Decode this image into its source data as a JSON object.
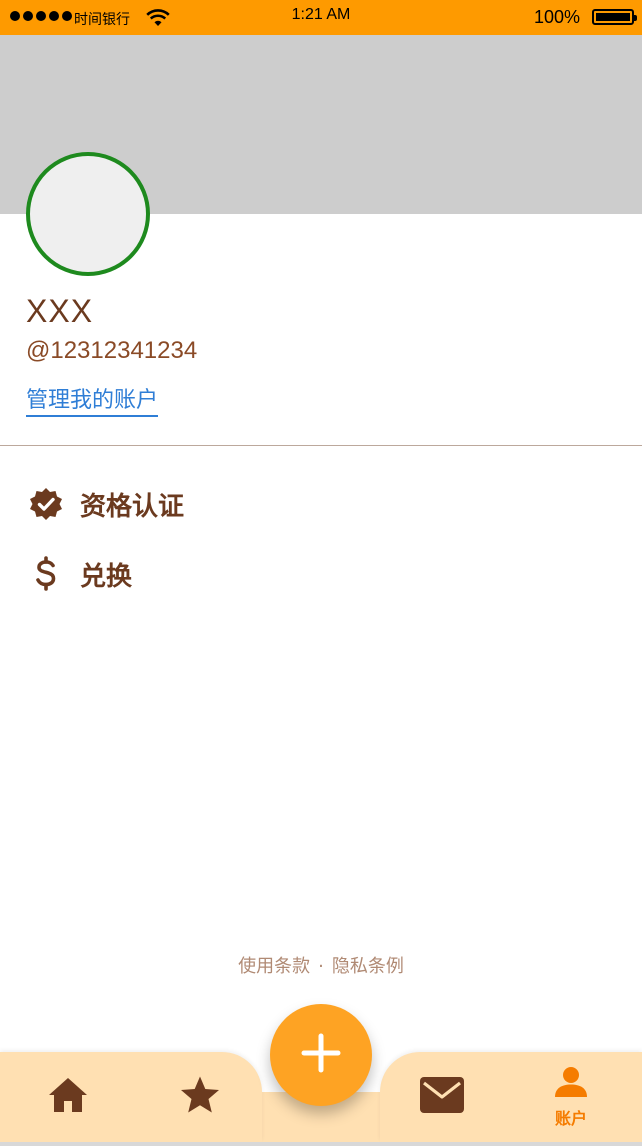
{
  "status_bar": {
    "carrier": "时间银行",
    "time": "1:21 AM",
    "battery": "100%"
  },
  "profile": {
    "name": "XXX",
    "handle": "@12312341234",
    "manage_link": "管理我的账户"
  },
  "menu": [
    {
      "label": "资格认证",
      "icon": "verified-badge-icon"
    },
    {
      "label": "兑换",
      "icon": "dollar-icon"
    }
  ],
  "footer": {
    "terms": "使用条款",
    "separator": "·",
    "privacy": "隐私条例"
  },
  "tabbar": {
    "tabs": [
      {
        "icon": "home-icon",
        "label": ""
      },
      {
        "icon": "star-icon",
        "label": ""
      },
      {
        "icon": "mail-icon",
        "label": ""
      },
      {
        "icon": "person-icon",
        "label": "账户",
        "active": true
      }
    ],
    "fab_icon": "plus-icon"
  },
  "colors": {
    "accent": "#fe9a00",
    "brown": "#6b3a1f",
    "link": "#2f7ed6",
    "avatar_border": "#1e8a1e",
    "tab_active": "#f57c00"
  }
}
